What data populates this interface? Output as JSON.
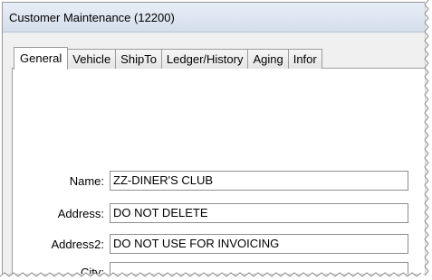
{
  "window": {
    "title": "Customer Maintenance (12200)"
  },
  "tabs": [
    {
      "label": "General",
      "active": true
    },
    {
      "label": "Vehicle",
      "active": false
    },
    {
      "label": "ShipTo",
      "active": false
    },
    {
      "label": "Ledger/History",
      "active": false
    },
    {
      "label": "Aging",
      "active": false
    },
    {
      "label": "Infor",
      "active": false
    }
  ],
  "fields": {
    "name": {
      "label": "Name:",
      "value": "ZZ-DINER'S CLUB"
    },
    "address": {
      "label": "Address:",
      "value": "DO NOT DELETE"
    },
    "address2": {
      "label": "Address2:",
      "value": "DO NOT USE FOR INVOICING"
    },
    "city": {
      "label": "City:",
      "value": ""
    }
  },
  "colors": {
    "titlebar": "#d9e3ef",
    "panel": "#ffffff",
    "window_bg": "#f0f0f0"
  }
}
